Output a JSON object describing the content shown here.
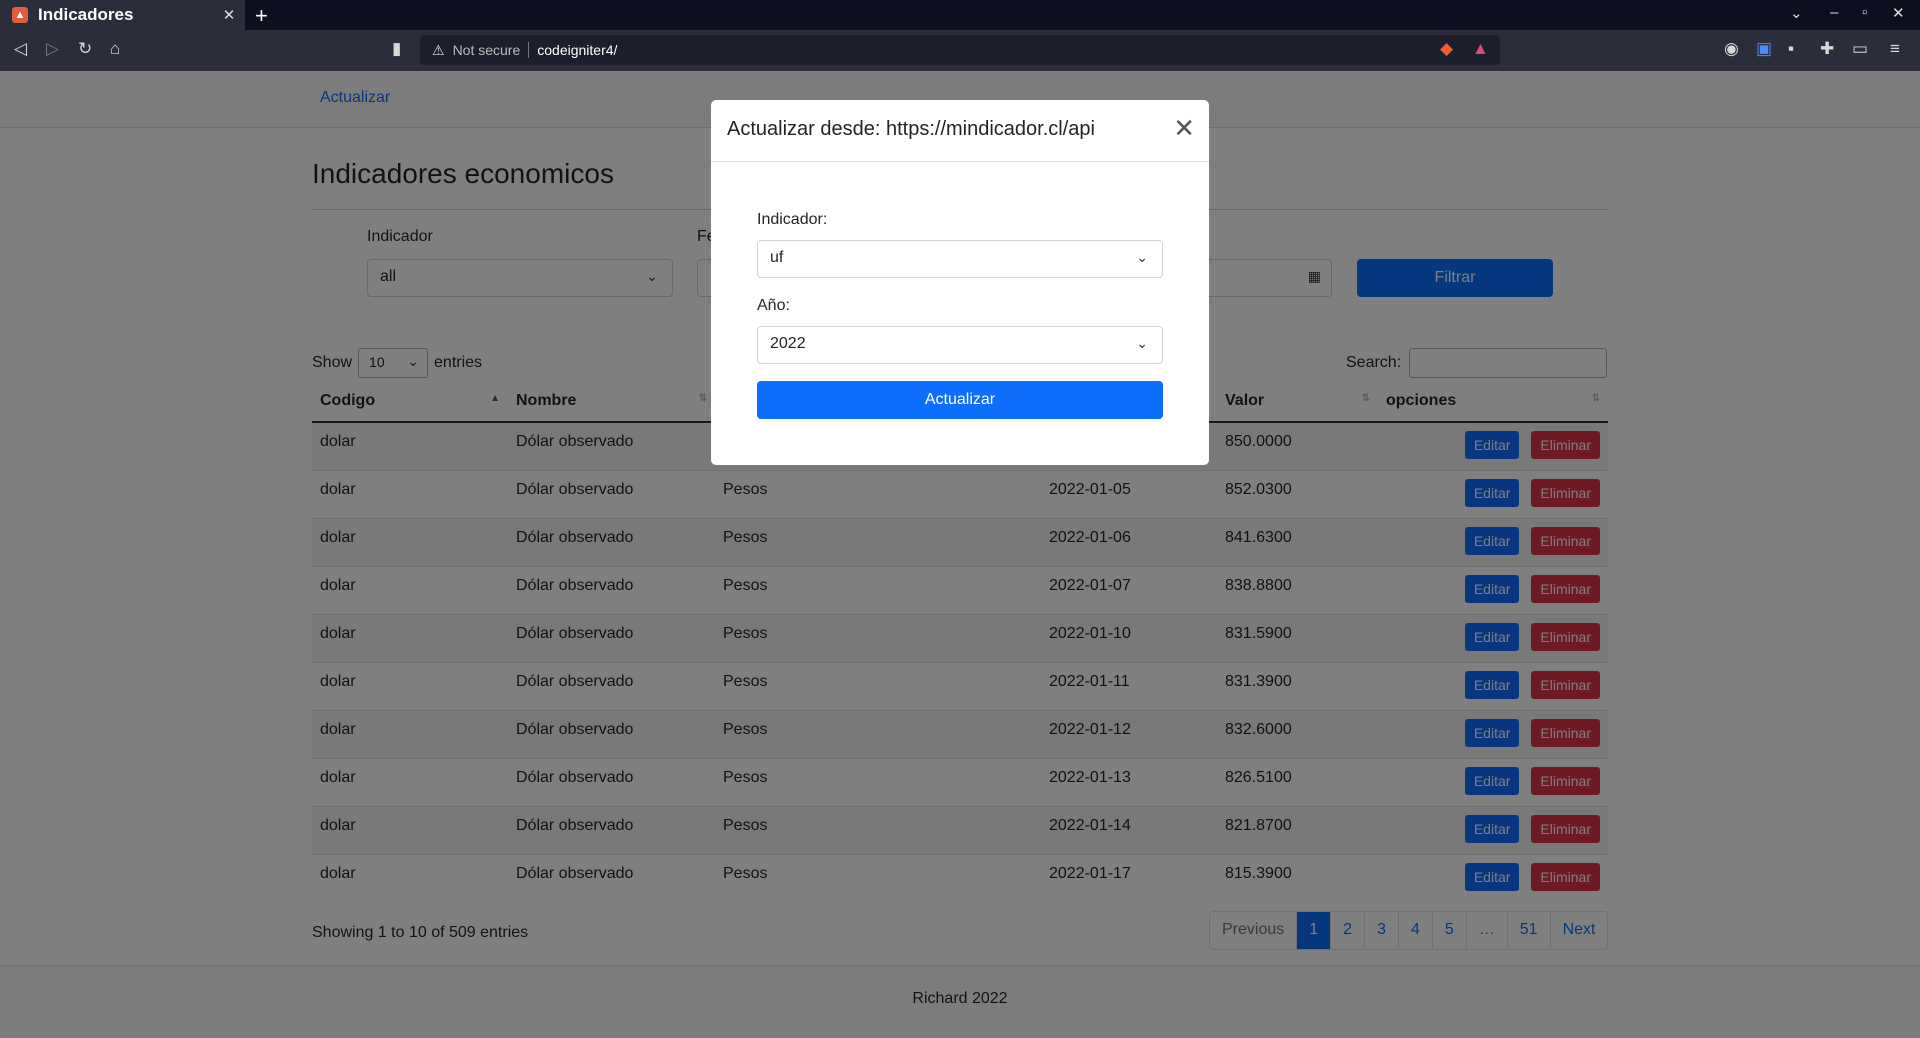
{
  "browser": {
    "tab_title": "Indicadores",
    "tab_close": "✕",
    "new_tab": "+",
    "security_label": "Not secure",
    "url": "codeigniter4/"
  },
  "nav": {
    "link": "Actualizar"
  },
  "page": {
    "title": "Indicadores economicos",
    "filter": {
      "indicador_label": "Indicador",
      "indicador_value": "all",
      "fecha_label_partial": "Fe",
      "button": "Filtrar"
    },
    "table_controls": {
      "show": "Show",
      "length": "10",
      "entries": "entries",
      "search_label": "Search:"
    },
    "columns": [
      "Codigo",
      "Nombre",
      "",
      "",
      "Valor",
      "opciones"
    ],
    "rows": [
      {
        "codigo": "dolar",
        "nombre": "Dólar observado",
        "unidad": "",
        "fecha": "",
        "valor": "850.0000"
      },
      {
        "codigo": "dolar",
        "nombre": "Dólar observado",
        "unidad": "Pesos",
        "fecha": "2022-01-05",
        "valor": "852.0300"
      },
      {
        "codigo": "dolar",
        "nombre": "Dólar observado",
        "unidad": "Pesos",
        "fecha": "2022-01-06",
        "valor": "841.6300"
      },
      {
        "codigo": "dolar",
        "nombre": "Dólar observado",
        "unidad": "Pesos",
        "fecha": "2022-01-07",
        "valor": "838.8800"
      },
      {
        "codigo": "dolar",
        "nombre": "Dólar observado",
        "unidad": "Pesos",
        "fecha": "2022-01-10",
        "valor": "831.5900"
      },
      {
        "codigo": "dolar",
        "nombre": "Dólar observado",
        "unidad": "Pesos",
        "fecha": "2022-01-11",
        "valor": "831.3900"
      },
      {
        "codigo": "dolar",
        "nombre": "Dólar observado",
        "unidad": "Pesos",
        "fecha": "2022-01-12",
        "valor": "832.6000"
      },
      {
        "codigo": "dolar",
        "nombre": "Dólar observado",
        "unidad": "Pesos",
        "fecha": "2022-01-13",
        "valor": "826.5100"
      },
      {
        "codigo": "dolar",
        "nombre": "Dólar observado",
        "unidad": "Pesos",
        "fecha": "2022-01-14",
        "valor": "821.8700"
      },
      {
        "codigo": "dolar",
        "nombre": "Dólar observado",
        "unidad": "Pesos",
        "fecha": "2022-01-17",
        "valor": "815.3900"
      }
    ],
    "row_actions": {
      "edit": "Editar",
      "delete": "Eliminar"
    },
    "info": "Showing 1 to 10 of 509 entries",
    "pagination": [
      "Previous",
      "1",
      "2",
      "3",
      "4",
      "5",
      "…",
      "51",
      "Next"
    ],
    "footer": "Richard 2022"
  },
  "modal": {
    "title": "Actualizar desde: https://mindicador.cl/api",
    "close": "✕",
    "indicador_label": "Indicador:",
    "indicador_value": "uf",
    "anio_label": "Año:",
    "anio_value": "2022",
    "button": "Actualizar"
  },
  "colors": {
    "primary": "#0d6efd",
    "danger": "#dc3545",
    "backdrop": "rgba(0,0,0,0.5)"
  }
}
